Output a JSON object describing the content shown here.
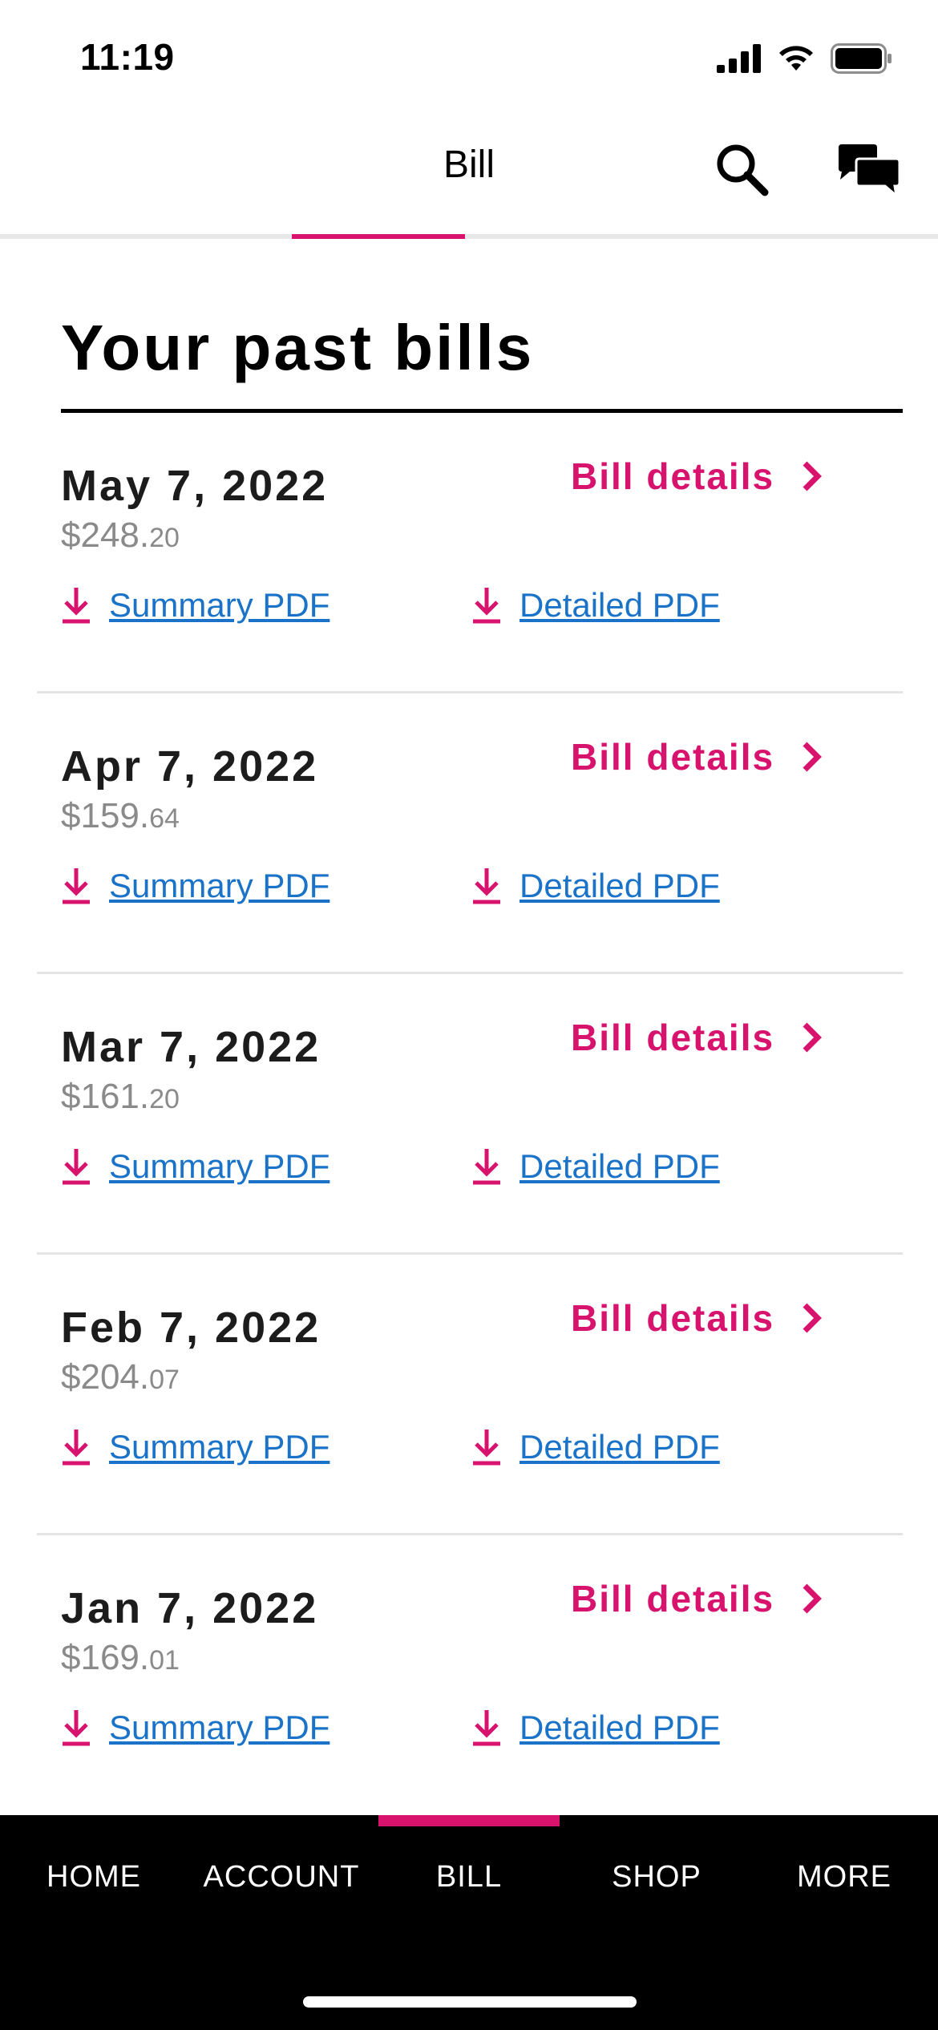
{
  "status_bar": {
    "time": "11:19"
  },
  "header": {
    "title": "Bill"
  },
  "page": {
    "title": "Your past bills"
  },
  "bills": [
    {
      "date": "May 7, 2022",
      "amount_main": "$248.",
      "amount_cents": "20",
      "details_label": "Bill details",
      "summary_label": "Summary PDF",
      "detailed_label": "Detailed PDF"
    },
    {
      "date": "Apr 7, 2022",
      "amount_main": "$159.",
      "amount_cents": "64",
      "details_label": "Bill details",
      "summary_label": "Summary PDF",
      "detailed_label": "Detailed PDF"
    },
    {
      "date": "Mar 7, 2022",
      "amount_main": "$161.",
      "amount_cents": "20",
      "details_label": "Bill details",
      "summary_label": "Summary PDF",
      "detailed_label": "Detailed PDF"
    },
    {
      "date": "Feb 7, 2022",
      "amount_main": "$204.",
      "amount_cents": "07",
      "details_label": "Bill details",
      "summary_label": "Summary PDF",
      "detailed_label": "Detailed PDF"
    },
    {
      "date": "Jan 7, 2022",
      "amount_main": "$169.",
      "amount_cents": "01",
      "details_label": "Bill details",
      "summary_label": "Summary PDF",
      "detailed_label": "Detailed PDF"
    }
  ],
  "bottom_nav": {
    "items": [
      {
        "label": "HOME"
      },
      {
        "label": "ACCOUNT"
      },
      {
        "label": "BILL",
        "active": true
      },
      {
        "label": "SHOP"
      },
      {
        "label": "MORE"
      }
    ]
  },
  "colors": {
    "accent": "#d8136e",
    "link": "#1a73c8",
    "amount": "#8a8a8a"
  },
  "icons": [
    "search-icon",
    "chat-icon",
    "download-icon",
    "chevron-right-icon",
    "cellular-signal-icon",
    "wifi-icon",
    "battery-icon"
  ]
}
